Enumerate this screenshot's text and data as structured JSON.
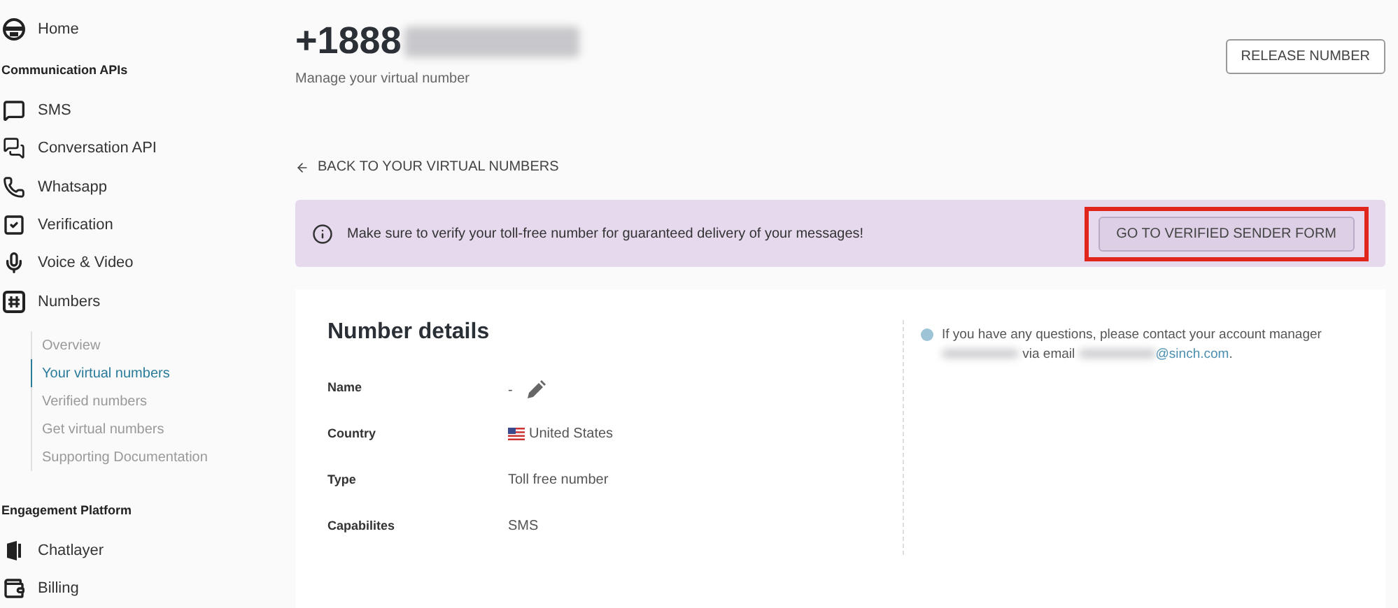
{
  "sidebar": {
    "items": [
      {
        "kind": "item",
        "label": "Home"
      },
      {
        "kind": "header",
        "label": "Communication APIs"
      },
      {
        "kind": "item",
        "label": "SMS"
      },
      {
        "kind": "item",
        "label": "Conversation API"
      },
      {
        "kind": "item",
        "label": "Whatsapp"
      },
      {
        "kind": "item",
        "label": "Verification"
      },
      {
        "kind": "item",
        "label": "Voice & Video"
      },
      {
        "kind": "item",
        "label": "Numbers",
        "children": [
          {
            "label": "Overview",
            "selected": false
          },
          {
            "label": "Your virtual numbers",
            "selected": true
          },
          {
            "label": "Verified numbers",
            "selected": false
          },
          {
            "label": "Get virtual numbers",
            "selected": false
          },
          {
            "label": "Supporting Documentation",
            "selected": false
          }
        ]
      },
      {
        "kind": "header",
        "label": "Engagement Platform"
      },
      {
        "kind": "item",
        "label": "Chatlayer"
      },
      {
        "kind": "item",
        "label": "Billing"
      }
    ]
  },
  "header": {
    "title": "+1888",
    "title_redacted": true,
    "subtitle": "Manage your virtual number",
    "action": "RELEASE NUMBER"
  },
  "back_link": "BACK TO YOUR VIRTUAL NUMBERS",
  "banner": {
    "text": "Make sure to verify your toll-free number for guaranteed delivery of your messages!",
    "button": "GO TO VERIFIED SENDER FORM",
    "highlighted": true
  },
  "card": {
    "title": "Number details",
    "fields": [
      {
        "kind": "editable",
        "label": "Name",
        "value": "-"
      },
      {
        "kind": "flag",
        "label": "Country",
        "value": "United States"
      },
      {
        "kind": "plain",
        "label": "Type",
        "value": "Toll free number"
      },
      {
        "kind": "plain",
        "label": "Capabilites",
        "value": "SMS"
      }
    ],
    "note": {
      "text": "If you have any questions, please contact your account manager",
      "middle": "via email",
      "email": "@sinch.com",
      "end": "."
    }
  }
}
